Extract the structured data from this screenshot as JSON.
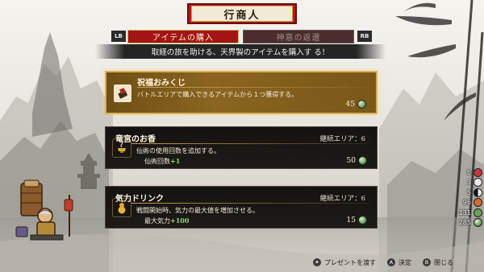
{
  "title": "行商人",
  "tabs": {
    "left_badge": "LB",
    "right_badge": "RB",
    "items": [
      {
        "label": "アイテムの購入",
        "active": true
      },
      {
        "label": "神意の返還",
        "active": false
      }
    ]
  },
  "banner": "取経の旅を助ける、天界製のアイテムを購入す る！",
  "items": [
    {
      "name": "祝福おみくじ",
      "icon": "fortune-slip-icon",
      "area": "",
      "description": "バトルエリアで購入できるアイテムから１つ獲得する。",
      "effect_label": "",
      "effect_value": "",
      "price": "45",
      "selected": true
    },
    {
      "name": "竜宮のお香",
      "icon": "incense-burner-icon",
      "area": "継続エリア：6",
      "description": "仙術の使用回数を追加する。",
      "effect_label": "仙術回数",
      "effect_value": "+1",
      "price": "50",
      "selected": false
    },
    {
      "name": "気力ドリンク",
      "icon": "gourd-drink-icon",
      "area": "継続エリア：6",
      "description": "戦闘開始時、気力の最大値を増加させる。",
      "effect_label": "最大気力",
      "effect_value": "+100",
      "price": "15",
      "selected": false
    }
  ],
  "stats": [
    {
      "value": "6",
      "icon": "red-gem-icon",
      "color": "#c23a3a"
    },
    {
      "value": "3",
      "icon": "white-orb-icon",
      "color": "#e8e8e8"
    },
    {
      "value": "5",
      "icon": "yin-yang-icon",
      "color": "#555555"
    },
    {
      "value": "96",
      "icon": "fire-orb-icon",
      "color": "#d86a2a"
    },
    {
      "value": "131",
      "icon": "jade-orb-icon",
      "color": "#6aa05a"
    },
    {
      "value": "285",
      "icon": "coin-icon",
      "color": "#7aa56a"
    }
  ],
  "footer": {
    "present_label": "プレゼントを渡す",
    "confirm_button": "A",
    "confirm_label": "決定",
    "close_button": "B",
    "close_label": "閉じる"
  }
}
